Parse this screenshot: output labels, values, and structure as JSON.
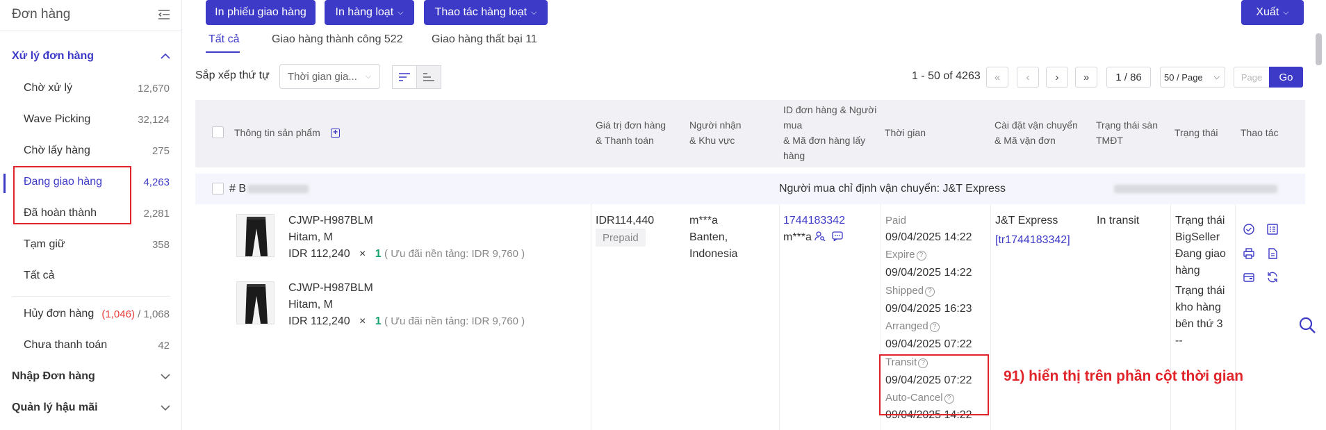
{
  "sidebar": {
    "title": "Đơn hàng",
    "sections": [
      {
        "label": "Xử lý đơn hàng"
      },
      {
        "label": "Nhập Đơn hàng"
      },
      {
        "label": "Quản lý hậu mãi"
      }
    ],
    "items": [
      {
        "label": "Chờ xử lý",
        "count": "12,670"
      },
      {
        "label": "Wave Picking",
        "count": "32,124"
      },
      {
        "label": "Chờ lấy hàng",
        "count": "275"
      },
      {
        "label": "Đang giao hàng",
        "count": "4,263"
      },
      {
        "label": "Đã hoàn thành",
        "count": "2,281"
      },
      {
        "label": "Tạm giữ",
        "count": "358"
      },
      {
        "label": "Tất cả",
        "count": ""
      }
    ],
    "cancel": {
      "label": "Hủy đơn hàng",
      "count_red": "(1,046)",
      "count_rest": "/ 1,068"
    },
    "unpaid": {
      "label": "Chưa thanh toán",
      "count": "42"
    }
  },
  "toolbar": {
    "print_delivery": "In phiếu giao hàng",
    "print_batch": "In hàng loạt",
    "batch_ops": "Thao tác hàng loạt",
    "export": "Xuất"
  },
  "tabs": [
    {
      "label": "Tất cả"
    },
    {
      "label": "Giao hàng thành công 522"
    },
    {
      "label": "Giao hàng thất bại 11"
    }
  ],
  "sort": {
    "label": "Sắp xếp thứ tự",
    "selected": "Thời gian gia..."
  },
  "pager": {
    "info": "1 - 50 of 4263",
    "page": "1 / 86",
    "size": "50 / Page",
    "page_placeholder": "Page",
    "go": "Go"
  },
  "table": {
    "headers": {
      "product": "Thông tin sản phẩm",
      "value_l1": "Giá trị đơn hàng",
      "value_l2": "& Thanh toán",
      "recv_l1": "Người nhận",
      "recv_l2": "& Khu vực",
      "id_l1": "ID đơn hàng & Người",
      "id_l2": "mua",
      "id_l3": "& Mã đơn hàng lấy",
      "id_l4": "hàng",
      "time": "Thời gian",
      "ship_l1": "Cài đặt vận chuyển",
      "ship_l2": "& Mã vận đơn",
      "ecom_l1": "Trạng thái sàn",
      "ecom_l2": "TMĐT",
      "status": "Trạng thái",
      "actions": "Thao tác"
    },
    "order": {
      "id_prefix": "# B",
      "buyer_shipping": "Người mua chỉ định vận chuyển: J&T Express",
      "products": [
        {
          "sku": "CJWP-H987BLM",
          "variant": "Hitam, M",
          "price": "IDR 112,240",
          "times": "×",
          "qty": "1",
          "discount": "( Ưu đãi nền tảng:  IDR 9,760 )"
        },
        {
          "sku": "CJWP-H987BLM",
          "variant": "Hitam, M",
          "price": "IDR 112,240",
          "times": "×",
          "qty": "1",
          "discount": "( Ưu đãi nền tảng:  IDR 9,760 )"
        }
      ],
      "total": "IDR114,440",
      "payment": "Prepaid",
      "recipient": [
        "m***a",
        "Banten,",
        "Indonesia"
      ],
      "order_id": "1744183342",
      "buyer": "m***a",
      "times": [
        {
          "label": "Paid",
          "value": "09/04/2025 14:22",
          "help": false
        },
        {
          "label": "Expire",
          "value": "09/04/2025 14:22",
          "help": true
        },
        {
          "label": "Shipped",
          "value": "09/04/2025 16:23",
          "help": true
        },
        {
          "label": "Arranged",
          "value": "09/04/2025 07:22",
          "help": true
        },
        {
          "label": "Transit",
          "value": "09/04/2025 07:22",
          "help": true
        },
        {
          "label": "Auto-Cancel",
          "value": "09/04/2025 14:22",
          "help": true
        }
      ],
      "carrier": "J&T Express",
      "tracking": "[tr1744183342]",
      "ecom_status": "In transit",
      "status_lines": [
        "Trạng thái",
        "BigSeller",
        "Đang giao",
        "hàng"
      ],
      "status_lines2": [
        "Trạng thái",
        "kho hàng",
        "bên thứ 3",
        "--"
      ]
    }
  },
  "annotation": "91) hiển thị trên phần cột thời gian"
}
